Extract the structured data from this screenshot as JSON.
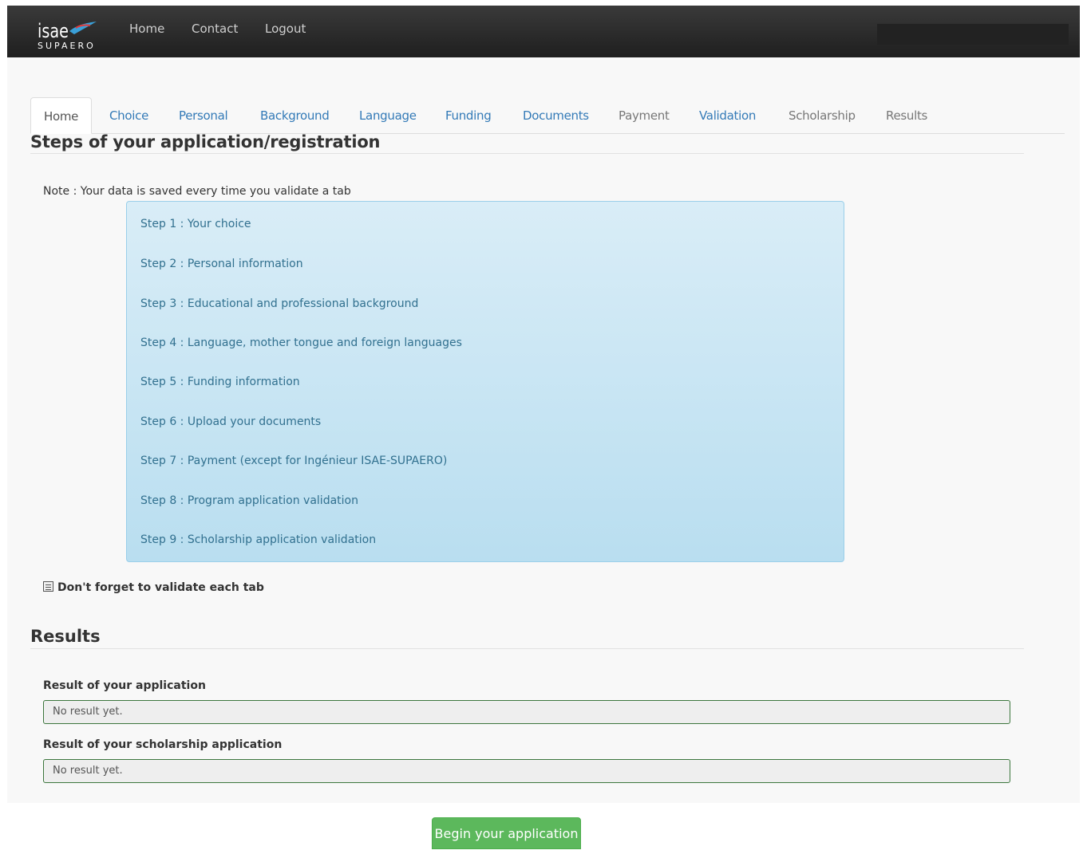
{
  "navbar": {
    "logo_text_top": "isae",
    "logo_text_bottom": "SUPAERO",
    "links": [
      "Home",
      "Contact",
      "Logout"
    ]
  },
  "tabs": [
    {
      "label": "Home",
      "state": "active"
    },
    {
      "label": "Choice",
      "state": "link"
    },
    {
      "label": "Personal",
      "state": "link"
    },
    {
      "label": "Background",
      "state": "link"
    },
    {
      "label": "Language",
      "state": "link"
    },
    {
      "label": "Funding",
      "state": "link"
    },
    {
      "label": "Documents",
      "state": "link"
    },
    {
      "label": "Payment",
      "state": "disabled"
    },
    {
      "label": "Validation",
      "state": "link"
    },
    {
      "label": "Scholarship",
      "state": "disabled"
    },
    {
      "label": "Results",
      "state": "disabled"
    }
  ],
  "steps_section": {
    "title": "Steps of your application/registration",
    "note": "Note : Your data is saved every time you validate a tab",
    "steps": [
      "Step 1 : Your choice",
      "Step 2 : Personal information",
      "Step 3 : Educational and professional background",
      "Step 4 : Language, mother tongue and foreign languages",
      "Step 5 : Funding information",
      "Step 6 : Upload your documents",
      "Step 7 : Payment (except for Ingénieur ISAE-SUPAERO)",
      "Step 8 : Program application validation",
      "Step 9 : Scholarship application validation"
    ],
    "reminder": "Don't forget to validate each tab"
  },
  "results_section": {
    "title": "Results",
    "application_label": "Result of your application",
    "application_value": "No result yet.",
    "scholarship_label": "Result of your scholarship application",
    "scholarship_value": "No result yet."
  },
  "begin_button": "Begin your application",
  "colors": {
    "navbar": "#2b2b2b",
    "link": "#337ab7",
    "info_bg": "#c9e6f4",
    "info_text": "#31708f",
    "success_button": "#5cb85c",
    "field_border": "#3c763d"
  }
}
